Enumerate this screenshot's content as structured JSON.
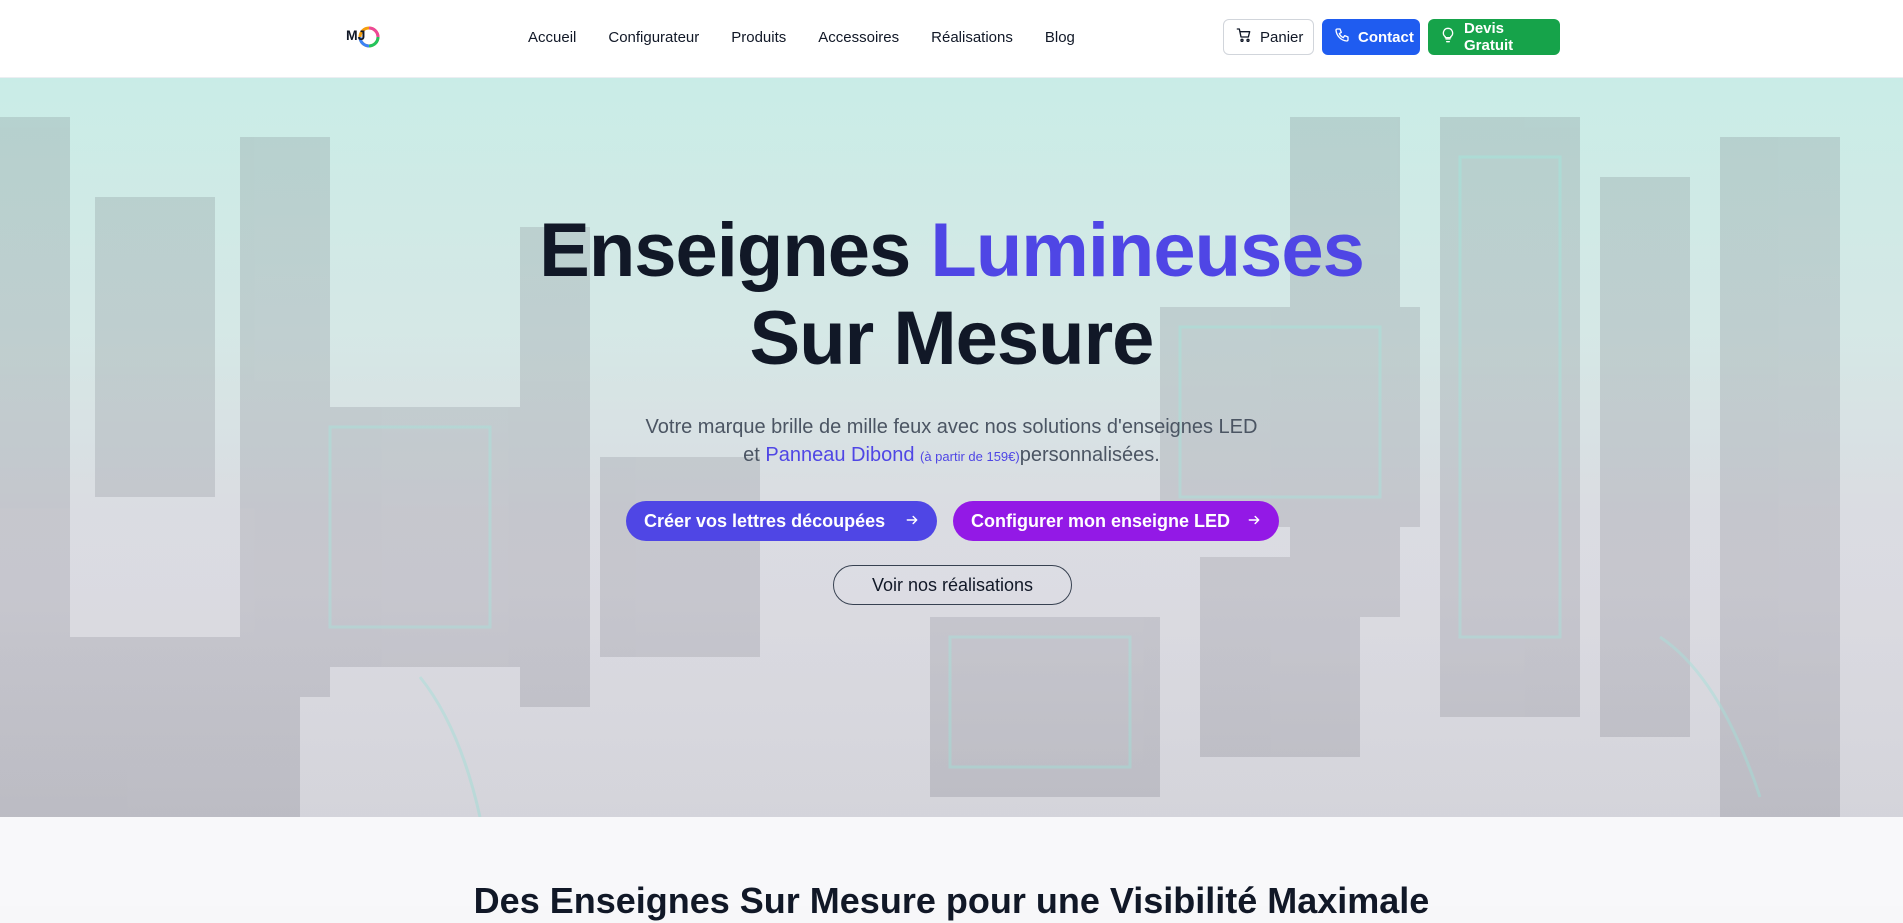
{
  "header": {
    "logo_text": "MJ",
    "nav": [
      {
        "label": "Accueil"
      },
      {
        "label": "Configurateur"
      },
      {
        "label": "Produits"
      },
      {
        "label": "Accessoires"
      },
      {
        "label": "Réalisations"
      },
      {
        "label": "Blog"
      }
    ],
    "cart_label": "Panier",
    "contact_label": "Contact",
    "devis_label": "Devis Gratuit",
    "icons": {
      "cart": "cart-icon",
      "contact": "phone-icon",
      "devis": "lightbulb-icon"
    },
    "colors": {
      "contact": "#1f5cf0",
      "devis": "#16a34a"
    }
  },
  "hero": {
    "title_part1": "Enseignes ",
    "title_accent": "Lumineuses",
    "title_line2": "Sur Mesure",
    "subtitle_line1": "Votre marque brille de mille feux avec nos solutions d'enseignes LED",
    "subtitle_pre": "et ",
    "subtitle_link": "Panneau Dibond",
    "subtitle_price": "(à partir de 159€)",
    "subtitle_post": "personnalisées.",
    "cta_primary": "Créer vos lettres découpées",
    "cta_secondary": "Configurer mon enseigne LED",
    "cta_outline": "Voir nos réalisations",
    "colors": {
      "accent": "#4f46e5",
      "cta_primary": "#4f46e5",
      "cta_secondary": "#9319e6"
    }
  },
  "section2": {
    "title": "Des Enseignes Sur Mesure pour une Visibilité Maximale"
  }
}
